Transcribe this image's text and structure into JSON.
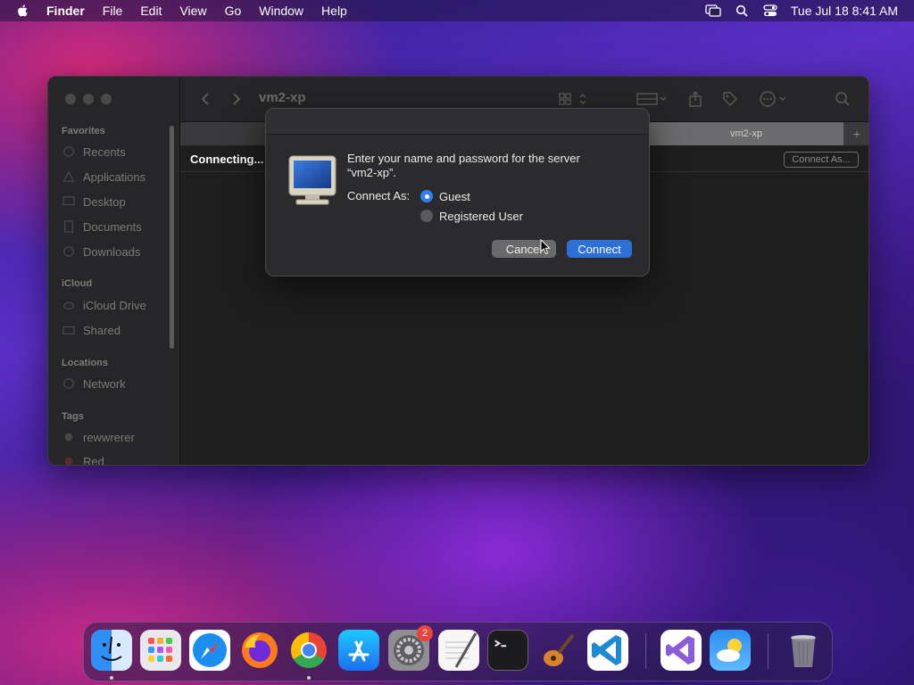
{
  "menubar": {
    "app_name": "Finder",
    "items": [
      "File",
      "Edit",
      "View",
      "Go",
      "Window",
      "Help"
    ],
    "clock": "Tue Jul 18  8:41 AM"
  },
  "finder": {
    "window_title": "vm2-xp",
    "tab_label": "vm2-xp",
    "tab_add": "+",
    "status": "Connecting...",
    "connect_as_button": "Connect As...",
    "sidebar": {
      "favorites_header": "Favorites",
      "favorites": [
        "Recents",
        "Applications",
        "Desktop",
        "Documents",
        "Downloads"
      ],
      "icloud_header": "iCloud",
      "icloud": [
        "iCloud Drive",
        "Shared"
      ],
      "locations_header": "Locations",
      "locations": [
        "Network"
      ],
      "tags_header": "Tags",
      "tags": [
        "rewwrerer",
        "Red"
      ]
    }
  },
  "dialog": {
    "message_line1": "Enter your name and password for the server",
    "message_line2": "“vm2-xp”.",
    "connect_as_label": "Connect As:",
    "option_guest": "Guest",
    "option_registered": "Registered User",
    "selected": "Guest",
    "cancel_label": "Cancel",
    "connect_label": "Connect"
  },
  "dock": {
    "apps": [
      "Finder",
      "Launchpad",
      "Safari",
      "Firefox",
      "Chrome",
      "App Store",
      "System Settings",
      "TextEdit",
      "Terminal",
      "GarageBand",
      "Visual Studio Code",
      "Visual Studio",
      "Weather",
      "Trash"
    ],
    "settings_badge": "2"
  },
  "colors": {
    "accent": "#2c6fd6",
    "radio_on": "#2f7ff0",
    "badge": "#e8453c"
  }
}
